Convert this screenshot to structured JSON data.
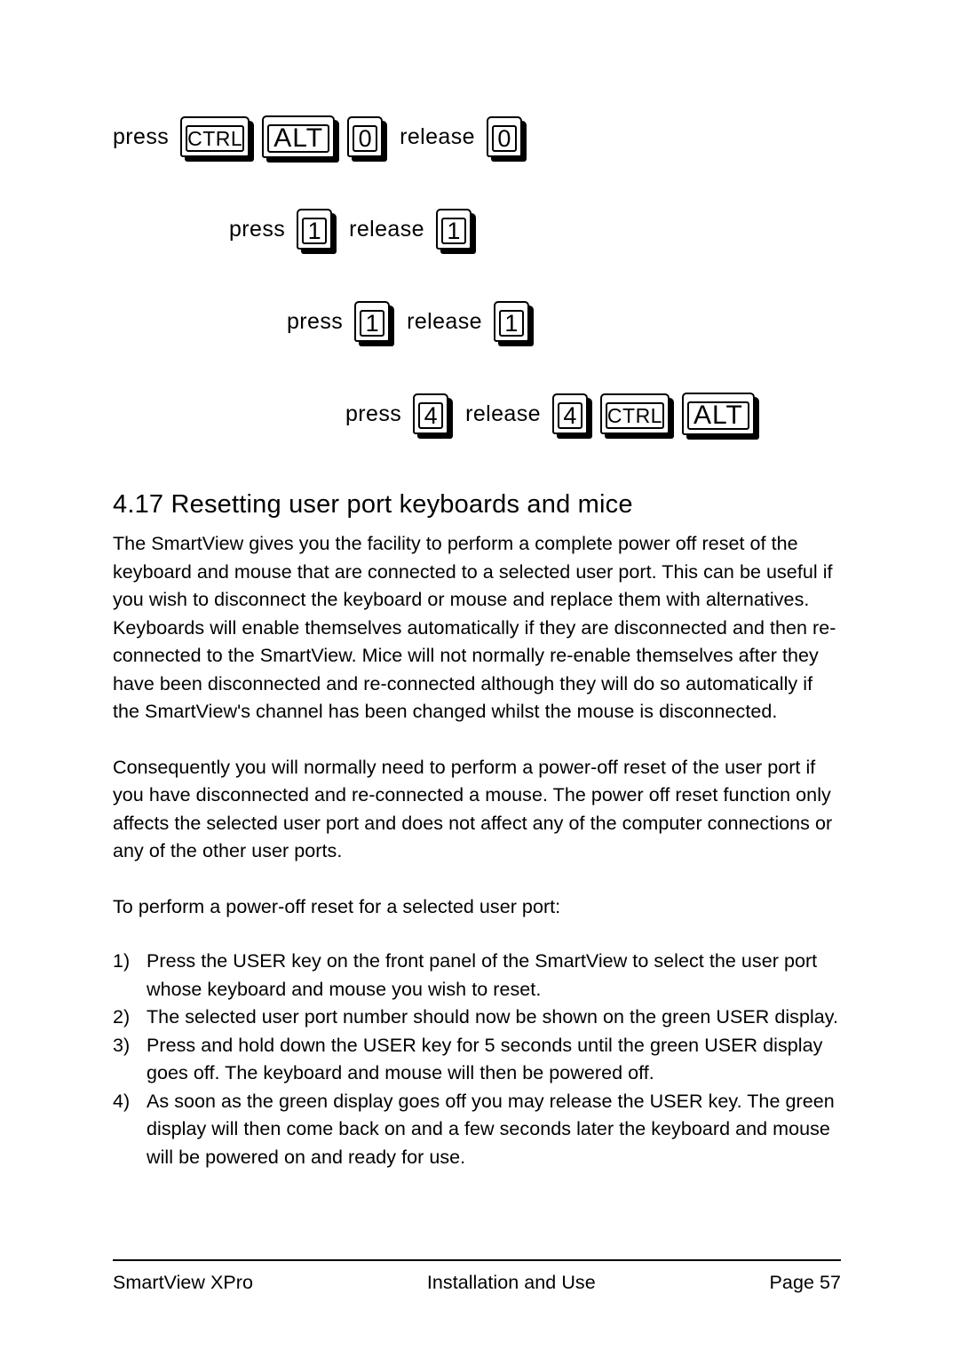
{
  "document": {
    "title": "SmartView XPro - Installation and Use - Page 57"
  },
  "key_sequences": {
    "rows": [
      {
        "indent": 127,
        "items": [
          {
            "kind": "word",
            "text": "press"
          },
          {
            "kind": "key",
            "label": "CTRL",
            "size": "wide"
          },
          {
            "kind": "key",
            "label": "ALT",
            "size": "wide-lg"
          },
          {
            "kind": "key",
            "label": "0",
            "size": "narrow"
          },
          {
            "kind": "word",
            "text": "release"
          },
          {
            "kind": "key",
            "label": "0",
            "size": "narrow"
          }
        ]
      },
      {
        "indent": 258,
        "items": [
          {
            "kind": "word",
            "text": "press"
          },
          {
            "kind": "key",
            "label": "1",
            "size": "narrow"
          },
          {
            "kind": "word",
            "text": "release"
          },
          {
            "kind": "key",
            "label": "1",
            "size": "narrow"
          }
        ]
      },
      {
        "indent": 323,
        "items": [
          {
            "kind": "word",
            "text": "press"
          },
          {
            "kind": "key",
            "label": "1",
            "size": "narrow"
          },
          {
            "kind": "word",
            "text": "release"
          },
          {
            "kind": "key",
            "label": "1",
            "size": "narrow"
          }
        ]
      },
      {
        "indent": 389,
        "items": [
          {
            "kind": "word",
            "text": "press"
          },
          {
            "kind": "key",
            "label": "4",
            "size": "narrow"
          },
          {
            "kind": "word",
            "text": "release"
          },
          {
            "kind": "key",
            "label": "4",
            "size": "narrow"
          },
          {
            "kind": "key",
            "label": "CTRL",
            "size": "wide"
          },
          {
            "kind": "key",
            "label": "ALT",
            "size": "wide-lg"
          }
        ]
      }
    ]
  },
  "section": {
    "heading": "4.17 Resetting user port keyboards and mice",
    "paragraphs": [
      "The SmartView gives you the facility to perform a complete power off reset of the keyboard and mouse that are connected to a selected user port. This can be useful if you wish to disconnect the keyboard or mouse and replace them with alternatives. Keyboards will enable themselves automatically if they are disconnected and then re-connected to the SmartView. Mice will not normally re-enable themselves after they have been disconnected and re-connected although they will do so automatically if the SmartView's channel has been changed whilst the mouse is disconnected.",
      "Consequently you will normally need to perform a power-off reset of the user port if you have disconnected and re-connected a mouse. The power off reset function only affects the selected user port and does not affect any of the computer connections or any of the other user ports.",
      "To perform a power-off reset for a selected user port:"
    ],
    "steps": [
      {
        "marker": "1)",
        "text": "Press the USER key on the front panel of the SmartView to select the user port whose keyboard and mouse you wish to reset."
      },
      {
        "marker": "2)",
        "text": "The selected user port number should now be shown on the green USER display."
      },
      {
        "marker": "3)",
        "text": "Press and hold down the USER key for 5 seconds until the green USER display goes off. The keyboard and mouse will then be powered off."
      },
      {
        "marker": "4)",
        "text": "As soon as the green display goes off you may release the USER key. The green display will then come back on and a few seconds later the keyboard and mouse will be powered on and ready for use."
      }
    ]
  },
  "footer": {
    "left": "SmartView XPro",
    "center": "Installation and Use",
    "right": "Page 57"
  }
}
